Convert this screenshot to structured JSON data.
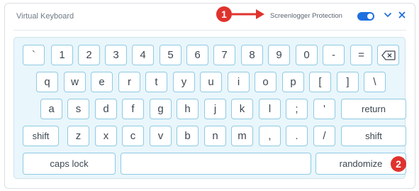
{
  "header": {
    "title": "Virtual Keyboard",
    "protection_label": "Screenlogger Protection",
    "protection_enabled": true,
    "accent_color": "#1f6fe0",
    "icons": [
      "chevron-down-icon",
      "close-icon"
    ]
  },
  "annotations": {
    "badge_1": "1",
    "badge_2": "2",
    "color": "#e0322d"
  },
  "keyboard": {
    "row1": [
      "`",
      "1",
      "2",
      "3",
      "4",
      "5",
      "6",
      "7",
      "8",
      "9",
      "0",
      "-",
      "="
    ],
    "backspace_icon": "backspace-icon",
    "row2": [
      "q",
      "w",
      "e",
      "r",
      "t",
      "y",
      "u",
      "i",
      "o",
      "p",
      "[",
      "]",
      "\\"
    ],
    "row3": [
      "a",
      "s",
      "d",
      "f",
      "g",
      "h",
      "j",
      "k",
      "l",
      ";",
      "'"
    ],
    "return_label": "return",
    "row4": [
      "z",
      "x",
      "c",
      "v",
      "b",
      "n",
      "m",
      ",",
      ".",
      "/"
    ],
    "shift_label": "shift",
    "caps_lock_label": "caps lock",
    "randomize_label": "randomize"
  }
}
